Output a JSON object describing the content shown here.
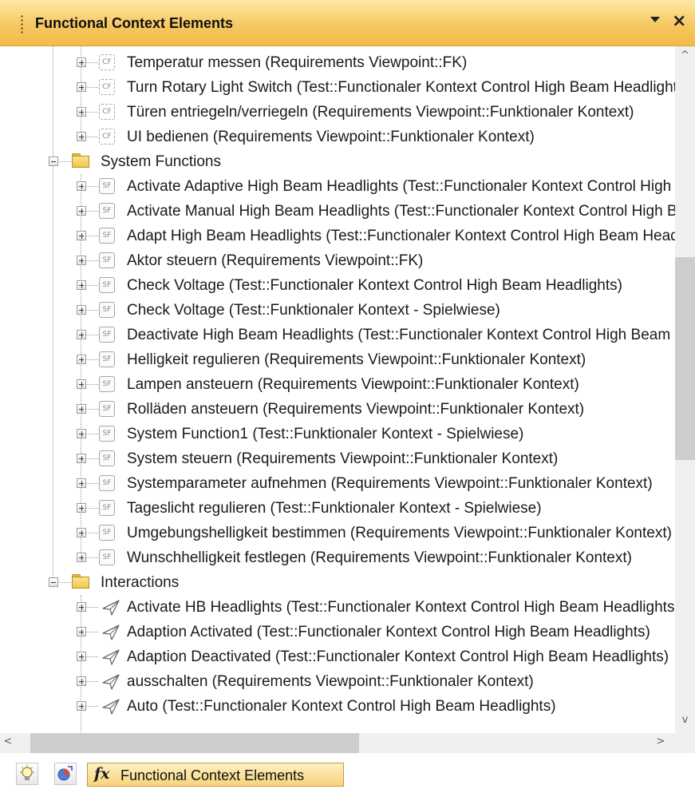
{
  "panel": {
    "title": "Functional Context Elements",
    "menu_icon": "dropdown-arrow-icon",
    "close_icon": "×"
  },
  "tree": {
    "items": [
      {
        "level": 2,
        "kind": "cf",
        "badge": "CF",
        "expander": "plus",
        "label": "Temperatur messen (Requirements Viewpoint::FK)"
      },
      {
        "level": 2,
        "kind": "cf",
        "badge": "CF",
        "expander": "plus",
        "label": "Turn Rotary Light Switch (Test::Functionaler Kontext Control High Beam Headlights)"
      },
      {
        "level": 2,
        "kind": "cf",
        "badge": "CF",
        "expander": "plus",
        "label": "Türen entriegeln/verriegeln (Requirements Viewpoint::Funktionaler Kontext)"
      },
      {
        "level": 2,
        "kind": "cf",
        "badge": "CF",
        "expander": "plus",
        "label": "UI bedienen (Requirements Viewpoint::Funktionaler Kontext)"
      },
      {
        "level": 1,
        "kind": "folder",
        "expander": "minus",
        "label": "System Functions"
      },
      {
        "level": 2,
        "kind": "sf",
        "badge": "SF",
        "expander": "plus",
        "label": "Activate Adaptive High Beam Headlights (Test::Functionaler Kontext Control High Beam Headlights)"
      },
      {
        "level": 2,
        "kind": "sf",
        "badge": "SF",
        "expander": "plus",
        "label": "Activate Manual High Beam Headlights (Test::Functionaler Kontext Control High Beam Headlights)"
      },
      {
        "level": 2,
        "kind": "sf",
        "badge": "SF",
        "expander": "plus",
        "label": "Adapt High Beam Headlights (Test::Functionaler Kontext Control High Beam Headlights)"
      },
      {
        "level": 2,
        "kind": "sf",
        "badge": "SF",
        "expander": "plus",
        "label": "Aktor steuern (Requirements Viewpoint::FK)"
      },
      {
        "level": 2,
        "kind": "sf",
        "badge": "SF",
        "expander": "plus",
        "label": "Check Voltage (Test::Functionaler Kontext Control High Beam Headlights)"
      },
      {
        "level": 2,
        "kind": "sf",
        "badge": "SF",
        "expander": "plus",
        "label": "Check Voltage (Test::Funktionaler Kontext - Spielwiese)"
      },
      {
        "level": 2,
        "kind": "sf",
        "badge": "SF",
        "expander": "plus",
        "label": "Deactivate High Beam Headlights (Test::Functionaler Kontext Control High Beam Headlights)"
      },
      {
        "level": 2,
        "kind": "sf",
        "badge": "SF",
        "expander": "plus",
        "label": "Helligkeit regulieren (Requirements Viewpoint::Funktionaler Kontext)"
      },
      {
        "level": 2,
        "kind": "sf",
        "badge": "SF",
        "expander": "plus",
        "label": "Lampen ansteuern (Requirements Viewpoint::Funktionaler Kontext)"
      },
      {
        "level": 2,
        "kind": "sf",
        "badge": "SF",
        "expander": "plus",
        "label": "Rolläden ansteuern (Requirements Viewpoint::Funktionaler Kontext)"
      },
      {
        "level": 2,
        "kind": "sf",
        "badge": "SF",
        "expander": "plus",
        "label": "System Function1 (Test::Funktionaler Kontext - Spielwiese)"
      },
      {
        "level": 2,
        "kind": "sf",
        "badge": "SF",
        "expander": "plus",
        "label": "System steuern (Requirements Viewpoint::Funktionaler Kontext)"
      },
      {
        "level": 2,
        "kind": "sf",
        "badge": "SF",
        "expander": "plus",
        "label": "Systemparameter aufnehmen (Requirements Viewpoint::Funktionaler Kontext)"
      },
      {
        "level": 2,
        "kind": "sf",
        "badge": "SF",
        "expander": "plus",
        "label": "Tageslicht regulieren (Test::Funktionaler Kontext - Spielwiese)"
      },
      {
        "level": 2,
        "kind": "sf",
        "badge": "SF",
        "expander": "plus",
        "label": "Umgebungshelligkeit bestimmen (Requirements Viewpoint::Funktionaler Kontext)"
      },
      {
        "level": 2,
        "kind": "sf",
        "badge": "SF",
        "expander": "plus",
        "label": "Wunschhelligkeit festlegen (Requirements Viewpoint::Funktionaler Kontext)"
      },
      {
        "level": 1,
        "kind": "folder",
        "expander": "minus",
        "label": "Interactions"
      },
      {
        "level": 2,
        "kind": "msg",
        "expander": "plus",
        "label": "Activate HB Headlights (Test::Functionaler Kontext Control High Beam Headlights)"
      },
      {
        "level": 2,
        "kind": "msg",
        "expander": "plus",
        "label": "Adaption Activated (Test::Functionaler Kontext Control High Beam Headlights)"
      },
      {
        "level": 2,
        "kind": "msg",
        "expander": "plus",
        "label": "Adaption Deactivated (Test::Functionaler Kontext Control High Beam Headlights)"
      },
      {
        "level": 2,
        "kind": "msg",
        "expander": "plus",
        "label": "ausschalten (Requirements Viewpoint::Funktionaler Kontext)"
      },
      {
        "level": 2,
        "kind": "msg",
        "expander": "plus",
        "label": "Auto (Test::Functionaler Kontext Control High Beam Headlights)"
      }
    ]
  },
  "scrollbars": {
    "up_arrow": "^",
    "down_arrow": "v",
    "left_arrow": "<",
    "right_arrow": ">"
  },
  "bottom_tabs": {
    "tab1_icon": "lightbulb-icon",
    "tab2_icon": "pie-chart-icon",
    "active_tab": {
      "icon_text": "fx",
      "label": "Functional Context Elements"
    }
  },
  "colors": {
    "title_bar": "#f6c862",
    "active_tab": "#f7d37a",
    "folder": "#f0c94a"
  }
}
